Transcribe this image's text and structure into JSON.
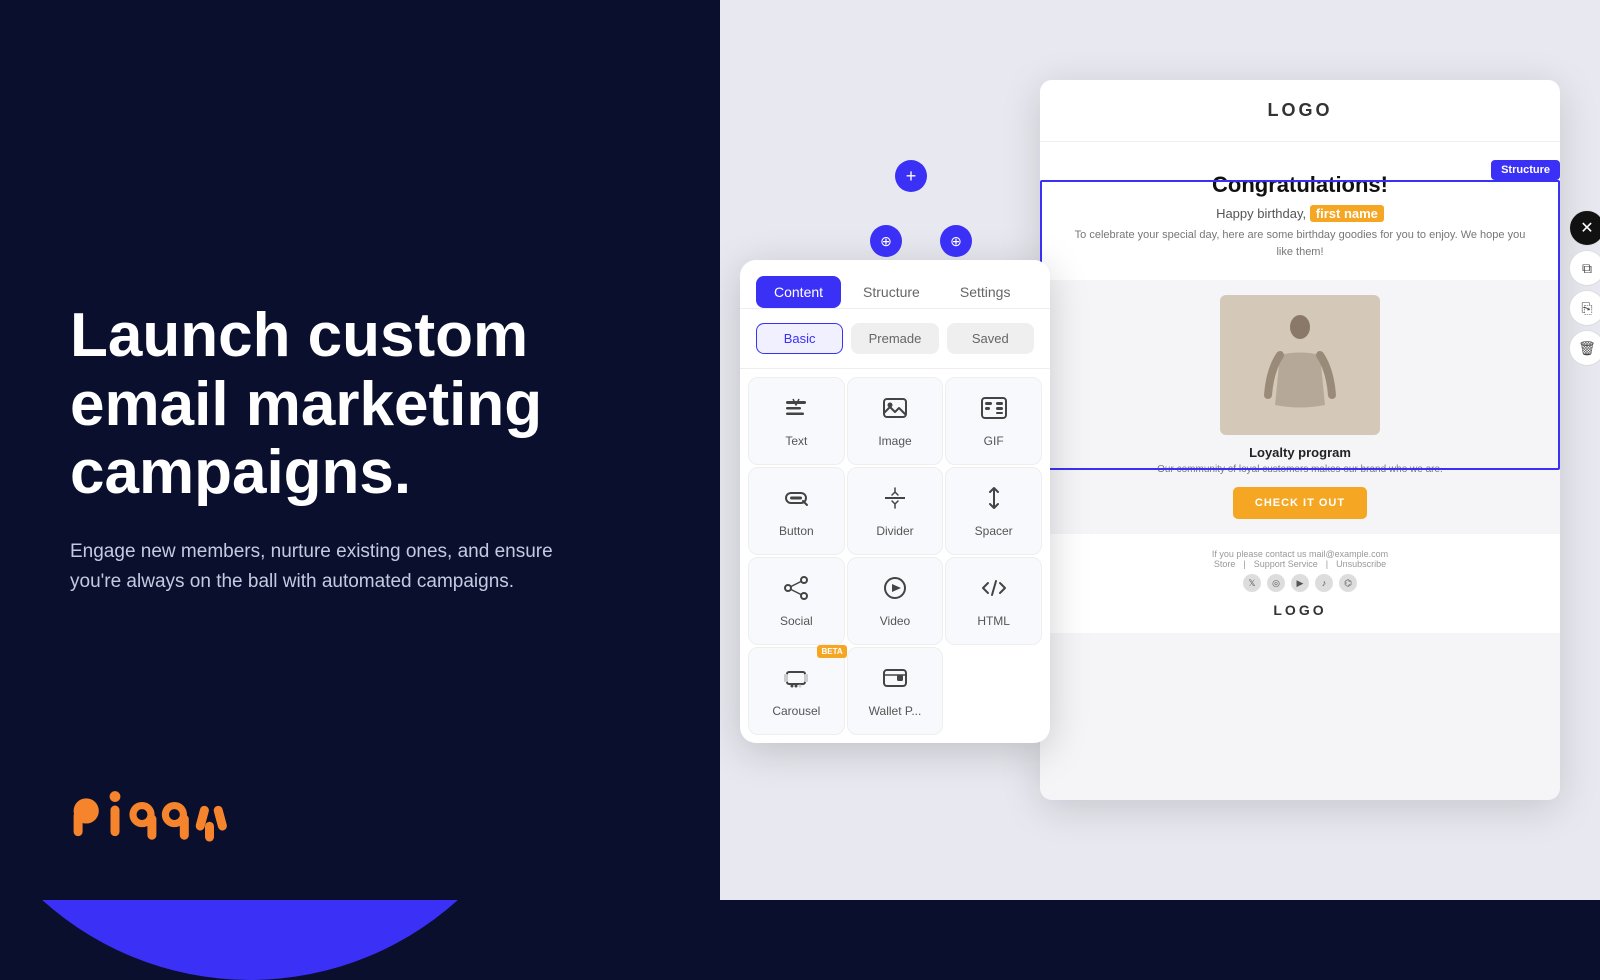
{
  "left": {
    "title": "Launch custom email marketing campaigns.",
    "subtitle": "Engage new members, nurture existing ones, and ensure you're always on the ball with automated campaigns.",
    "logo_text": "piggy"
  },
  "right": {
    "email": {
      "header_logo": "LOGO",
      "congrats_title": "Congratulations!",
      "birthday_line": "Happy birthday,",
      "birthday_highlight": "first name",
      "body_text": "To celebrate your special day, here are some birthday goodies for you to enjoy. We hope you like them!",
      "product_title": "Loyalty program",
      "product_desc": "Our community of loyal customers makes our brand who we are.",
      "cta_text": "CHECK IT OUT",
      "footer_text": "If you please contact us mail@example.com",
      "footer_links": [
        "Store",
        "Support Service",
        "Unsubscribe"
      ],
      "footer_logo": "LOGO",
      "structure_badge": "Structure"
    },
    "panel": {
      "tabs": [
        "Content",
        "Structure",
        "Settings"
      ],
      "active_tab": "Content",
      "subtabs": [
        "Basic",
        "Premade",
        "Saved"
      ],
      "active_subtab": "Basic",
      "elements": [
        {
          "icon": "text",
          "label": "Text",
          "beta": false
        },
        {
          "icon": "image",
          "label": "Image",
          "beta": false
        },
        {
          "icon": "gif",
          "label": "GIF",
          "beta": false
        },
        {
          "icon": "button",
          "label": "Button",
          "beta": false
        },
        {
          "icon": "divider",
          "label": "Divider",
          "beta": false
        },
        {
          "icon": "spacer",
          "label": "Spacer",
          "beta": false
        },
        {
          "icon": "social",
          "label": "Social",
          "beta": false
        },
        {
          "icon": "video",
          "label": "Video",
          "beta": false
        },
        {
          "icon": "html",
          "label": "HTML",
          "beta": false
        },
        {
          "icon": "carousel",
          "label": "Carousel",
          "beta": true
        },
        {
          "icon": "wallet",
          "label": "Wallet P...",
          "beta": false
        }
      ]
    }
  }
}
